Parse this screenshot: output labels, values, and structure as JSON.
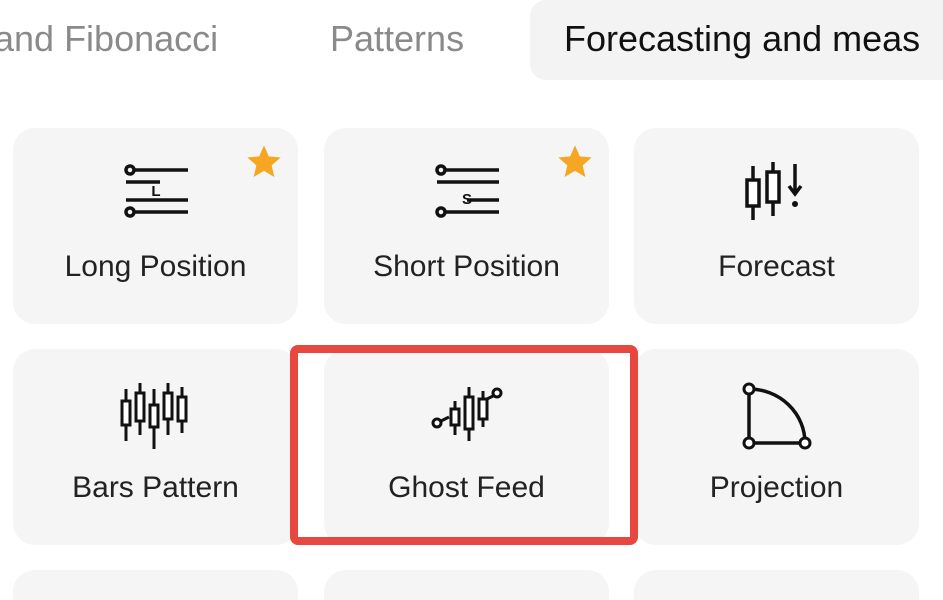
{
  "tabs": [
    {
      "label": "and Fibonacci",
      "active": false
    },
    {
      "label": "Patterns",
      "active": false
    },
    {
      "label": "Forecasting and meas",
      "active": true
    }
  ],
  "tools": [
    {
      "label": "Long Position",
      "icon": "long-position-icon",
      "starred": true
    },
    {
      "label": "Short Position",
      "icon": "short-position-icon",
      "starred": true
    },
    {
      "label": "Forecast",
      "icon": "forecast-icon",
      "starred": false
    },
    {
      "label": "Bars Pattern",
      "icon": "bars-pattern-icon",
      "starred": false
    },
    {
      "label": "Ghost Feed",
      "icon": "ghost-feed-icon",
      "starred": false,
      "highlighted": true
    },
    {
      "label": "Projection",
      "icon": "projection-icon",
      "starred": false
    }
  ],
  "icon_letters": {
    "long": "L",
    "short": "S"
  },
  "colors": {
    "star": "#f5a623",
    "highlight": "#e8473f",
    "card_bg": "#f5f5f5",
    "active_tab_bg": "#f3f3f3"
  }
}
